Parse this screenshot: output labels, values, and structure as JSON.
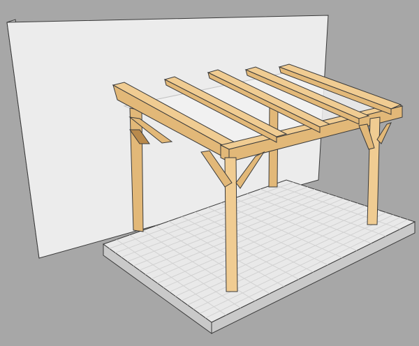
{
  "scene": {
    "subject": "pergola-3d-model",
    "colors": {
      "background": "#a7a7a7",
      "wall_front": "#ececec",
      "wall_side": "#bdbdbd",
      "floor_top": "#e9e9e9",
      "floor_side": "#c9c9c9",
      "tile_line": "#d2d2d2",
      "timber": "#e2b878",
      "timber_light": "#f0cc92",
      "timber_dark": "#b98a4c",
      "roof_glass": "#f2f2f2",
      "edge": "#3a3a3a"
    }
  }
}
